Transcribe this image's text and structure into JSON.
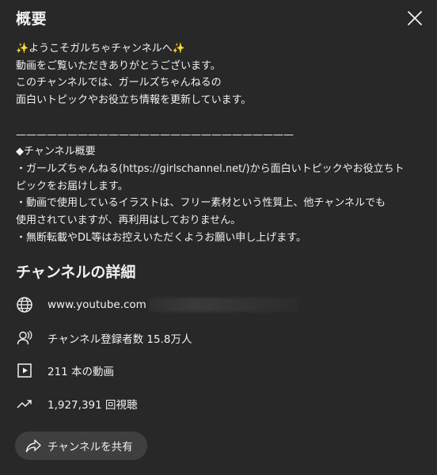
{
  "header": {
    "title": "概要",
    "close_icon": "close-icon"
  },
  "description": {
    "text": "✨ようこそガルちゃチャンネルへ✨\n動画をご覧いただきありがとうございます。\nこのチャンネルでは、ガールズちゃんねるの\n面白いトピックやお役立ち情報を更新しています。\n\n———————————————————————————\n◆チャンネル概要\n・ガールズちゃんねる(https://girlschannel.net/)から面白いトピックやお役立ちト\nピックをお届けします。\n・動画で使用しているイラストは、フリー素材という性質上、他チャンネルでも\n使用されていますが、再利用はしておりません。\n・無断転載やDL等はお控えいただくようお願い申し上げます。"
  },
  "details": {
    "title": "チャンネルの詳細",
    "url": "www.youtube.com",
    "subscribers": "チャンネル登録者数 15.8万人",
    "videos": "211 本の動画",
    "views": "1,927,391 回視聴",
    "icons": [
      "globe-icon",
      "subscribers-icon",
      "video-icon",
      "trending-icon"
    ]
  },
  "share": {
    "label": "チャンネルを共有",
    "icon": "share-icon"
  }
}
